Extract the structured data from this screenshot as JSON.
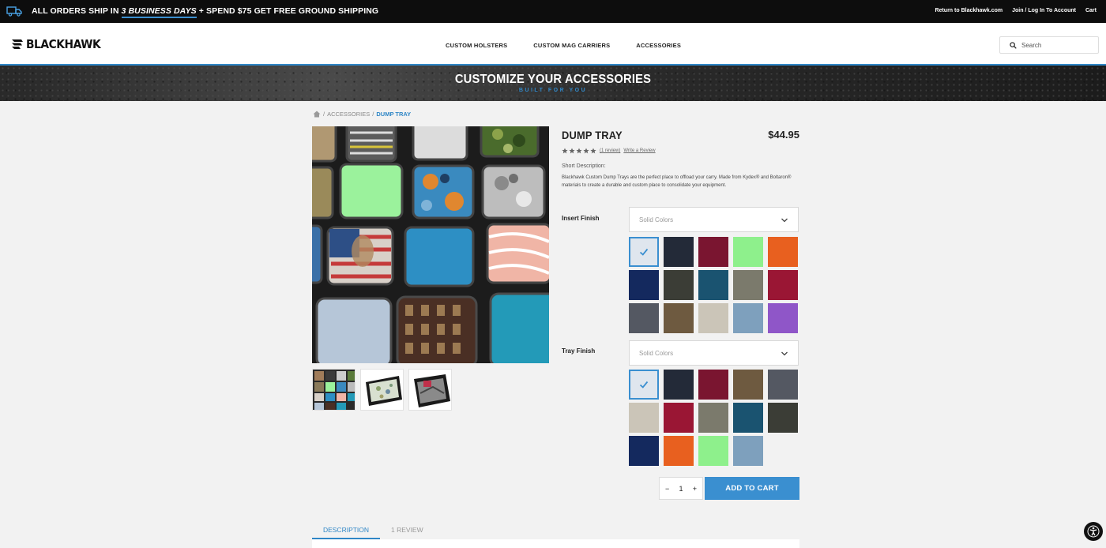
{
  "promo": {
    "icon": "truck-icon",
    "text_before": "ALL ORDERS SHIP IN ",
    "text_emphasis": "3 BUSINESS DAYS",
    "text_after": " + SPEND $75 GET FREE GROUND SHIPPING",
    "links": [
      "Return to Blackhawk.com",
      "Join / Log In To Account",
      "Cart"
    ]
  },
  "header": {
    "logo": "BLACKHAWK",
    "nav": [
      "CUSTOM HOLSTERS",
      "CUSTOM MAG CARRIERS",
      "ACCESSORIES"
    ],
    "search_placeholder": "Search"
  },
  "banner": {
    "title": "CUSTOMIZE YOUR ACCESSORIES",
    "subtitle": "BUILT FOR YOU"
  },
  "breadcrumb": {
    "parent": "ACCESSORIES",
    "current": "DUMP TRAY",
    "separator": "/"
  },
  "product": {
    "title": "DUMP TRAY",
    "price": "$44.95",
    "rating": 5,
    "review_count_text": "(1 review)",
    "write_review": "Write a Review",
    "short_description_label": "Short Description:",
    "short_description": "Blackhawk Custom Dump Trays are the perfect place to offload your carry. Made from Kydex® and Boltaron® materials to create a durable and custom place to consolidate your equipment."
  },
  "options": {
    "insert_finish": {
      "label": "Insert Finish",
      "select_value": "Solid Colors",
      "selected_index": 0,
      "swatches": [
        "#dfe6ee",
        "#232a38",
        "#7a1530",
        "#8ef08c",
        "#e8601f",
        "#14295e",
        "#3b3d36",
        "#1a5370",
        "#7b7a6c",
        "#9a1634",
        "#545862",
        "#6e5a40",
        "#cbc5b8",
        "#7ea0bd",
        "#8f56c8"
      ]
    },
    "tray_finish": {
      "label": "Tray Finish",
      "select_value": "Solid Colors",
      "selected_index": 0,
      "swatches": [
        "#dfe6ee",
        "#232a38",
        "#7a1530",
        "#6e5a40",
        "#545862",
        "#cbc5b8",
        "#9a1634",
        "#7b7a6c",
        "#1a5370",
        "#3b3d36",
        "#14295e",
        "#e8601f",
        "#8ef08c",
        "#7ea0bd"
      ]
    }
  },
  "cart": {
    "quantity": "1",
    "minus": "−",
    "plus": "+",
    "add_label": "ADD TO CART"
  },
  "tabs": [
    "DESCRIPTION",
    "1 REVIEW"
  ],
  "accessibility": "accessibility-icon"
}
